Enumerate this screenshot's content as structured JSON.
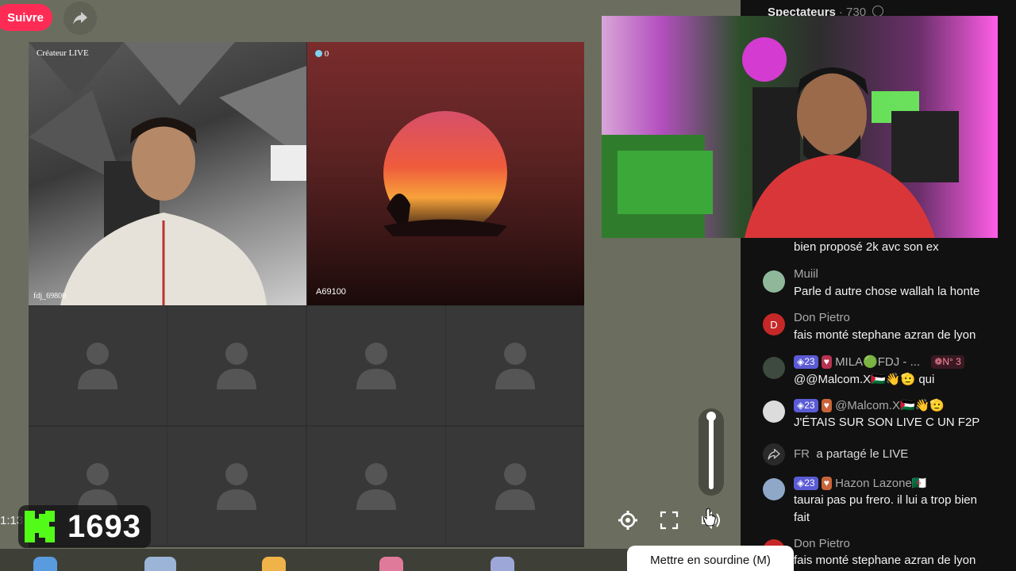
{
  "header": {
    "follow_label": "Suivre"
  },
  "grid": {
    "creator_label": "Créateur LIVE",
    "creator_name": "fdj_69800",
    "guest_badge_count": "0",
    "guest_name": "A69100"
  },
  "sidebar": {
    "viewers_label": "Spectateurs",
    "viewers_count": "· 730",
    "partial_msg": "bien proposé 2k avc son ex",
    "chat": [
      {
        "user": "Muiil",
        "message": "Parle d autre chose wallah la honte"
      },
      {
        "user": "Don Pietro",
        "avatar_letter": "D",
        "message": "fais monté stephane azran de lyon"
      },
      {
        "level": "23",
        "user": "MILA🟢FDJ - ...",
        "rank": "N° 3",
        "message": "@@Malcom.X🇵🇸👋🫡 qui"
      },
      {
        "level": "23",
        "user": "@Malcom.X🇵🇸👋🫡",
        "message": "J'ÉTAIS SUR SON LIVE C UN F2P"
      },
      {
        "user": "FR",
        "message": "a partagé le LIVE"
      },
      {
        "level": "23",
        "user": "Hazon Lazone🇩🇿",
        "message": "taurai pas pu frero. il lui a trop bien",
        "message2": "fait"
      },
      {
        "user": "Don Pietro",
        "message": "fais monté stephane azran de lyon"
      }
    ]
  },
  "overlay": {
    "timer": "1:13",
    "kick_count": "1693"
  },
  "controls": {
    "mute_tooltip": "Mettre en sourdine (M)",
    "volume_level": 1.0
  },
  "colors": {
    "follow": "#fe2c55",
    "kick_green": "#53fc18",
    "level_badge": "#5b5bd6"
  }
}
